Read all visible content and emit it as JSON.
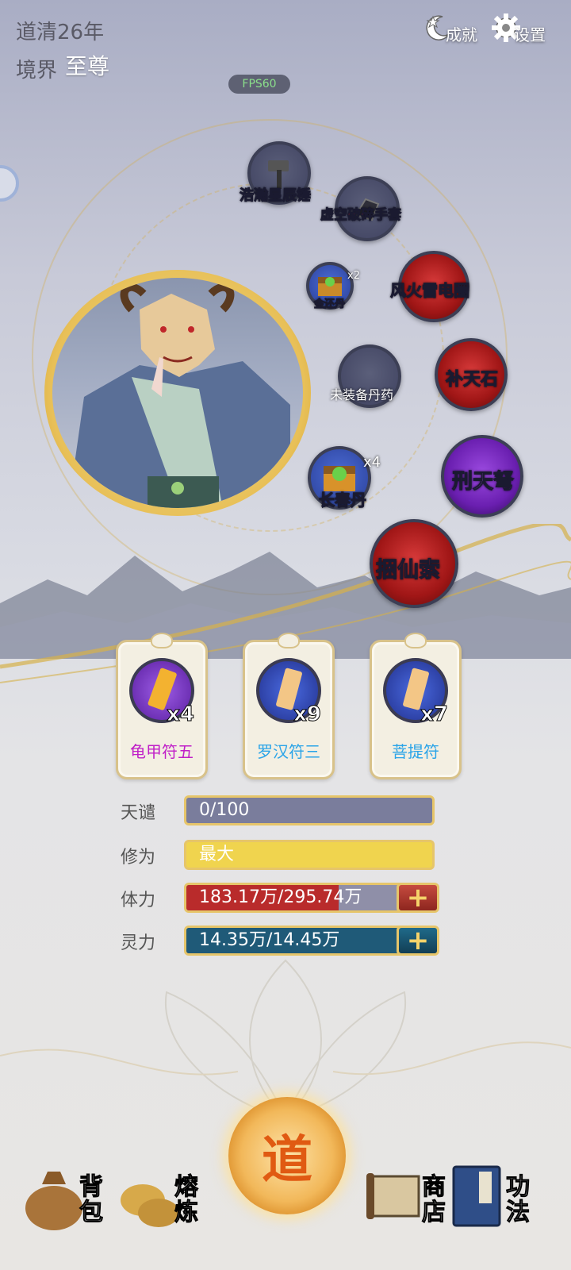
{
  "header": {
    "year": "道清26年",
    "realm_label": "境界",
    "realm_value": "至尊",
    "fps": "FPS60",
    "achievements_label": "成就",
    "settings_label": "设置"
  },
  "equipment": [
    {
      "name": "浩瀚星辰锤",
      "color": "red"
    },
    {
      "name": "虚空破碎手套",
      "color": "red"
    },
    {
      "name": "金还丹",
      "count": "x2",
      "color": "purple"
    },
    {
      "name": "风火雷电圈",
      "color": "red"
    },
    {
      "name": "未装备丹药",
      "color": "white"
    },
    {
      "name": "补天石",
      "color": "red"
    },
    {
      "name": "长春丹",
      "count": "x4",
      "color": "blue"
    },
    {
      "name": "刑天弩",
      "color": "purple"
    },
    {
      "name": "捆仙索",
      "color": "red"
    }
  ],
  "talismans": [
    {
      "name": "龟甲符五",
      "count": "x4",
      "color": "#c020c8"
    },
    {
      "name": "罗汉符三",
      "count": "x9",
      "color": "#2aa4e8"
    },
    {
      "name": "菩提符",
      "count": "x7",
      "color": "#2aa4e8"
    }
  ],
  "stats": [
    {
      "label": "天谴",
      "value": "0/100",
      "fill": 1.0,
      "color": "#7a7d9c"
    },
    {
      "label": "修为",
      "value": "最大",
      "fill": 1.0,
      "color": "#f0d44e"
    },
    {
      "label": "体力",
      "value": "183.17万/295.74万",
      "fill": 0.62,
      "color": "#b92b2b"
    },
    {
      "label": "灵力",
      "value": "14.35万/14.45万",
      "fill": 0.99,
      "color": "#1f5a78"
    }
  ],
  "nav": {
    "bag": "背包",
    "smelt": "熔炼",
    "dao": "道",
    "shop": "商店",
    "skills": "功法"
  },
  "colors": {
    "gold": "#e6c56a",
    "health_red": "#b92b2b",
    "mana_teal": "#1f5a78"
  }
}
